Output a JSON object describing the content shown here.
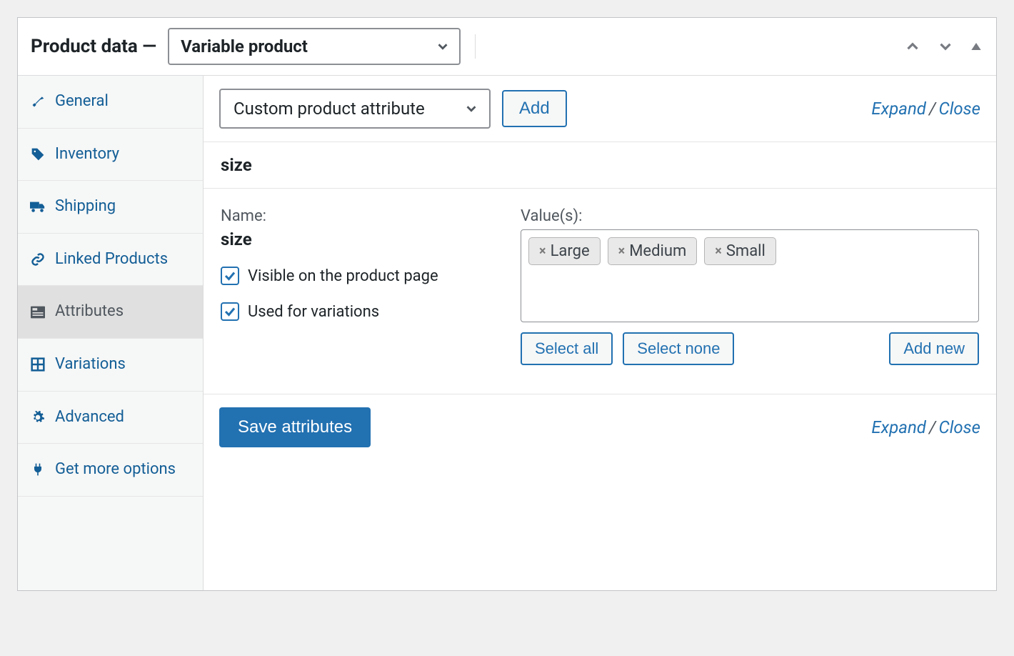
{
  "panel": {
    "title": "Product data —",
    "product_type": "Variable product"
  },
  "sidebar": {
    "items": [
      {
        "label": "General"
      },
      {
        "label": "Inventory"
      },
      {
        "label": "Shipping"
      },
      {
        "label": "Linked Products"
      },
      {
        "label": "Attributes"
      },
      {
        "label": "Variations"
      },
      {
        "label": "Advanced"
      },
      {
        "label": "Get more options"
      }
    ]
  },
  "toolbar": {
    "attribute_select": "Custom product attribute",
    "add": "Add",
    "expand": "Expand",
    "close": "Close"
  },
  "attribute": {
    "title": "size",
    "name_label": "Name:",
    "name_value": "size",
    "values_label": "Value(s):",
    "visible_label": "Visible on the product page",
    "used_label": "Used for variations",
    "tags": [
      "Large",
      "Medium",
      "Small"
    ],
    "select_all": "Select all",
    "select_none": "Select none",
    "add_new": "Add new"
  },
  "footer": {
    "save": "Save attributes",
    "expand": "Expand",
    "close": "Close"
  }
}
